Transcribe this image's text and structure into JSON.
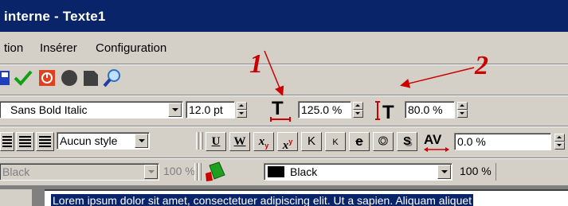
{
  "window": {
    "title": "interne - Texte1"
  },
  "menu": {
    "items": [
      "tion",
      "Insérer",
      "Configuration"
    ]
  },
  "toolbar": {
    "font_name": "Sans Bold Italic",
    "font_size": "12.0 pt",
    "char_spacing": "125.0 %",
    "line_spacing": "80.0 %",
    "style": "Aucun style",
    "kerning": "0.0 %",
    "fg_color_name": "Black",
    "fg_opacity": "100 %",
    "bg_color_name": "Black",
    "bg_opacity": "100 %",
    "btn_underline": "U",
    "btn_word_underline": "W",
    "btn_subscript": "x",
    "btn_superscript": "x",
    "btn_caps": "K",
    "btn_small_caps": "K",
    "btn_strike": "e",
    "btn_outline": "O",
    "btn_shadow": "S"
  },
  "annotations": {
    "one": "1",
    "two": "2"
  },
  "document": {
    "first_line": "Lorem ipsum dolor sit amet, consectetuer adipiscing elit. Ut a sapien. Aliquam aliquet"
  },
  "colors": {
    "titlebar": "#0a246a",
    "annotation": "#cc0000",
    "selection": "#0a246a"
  }
}
